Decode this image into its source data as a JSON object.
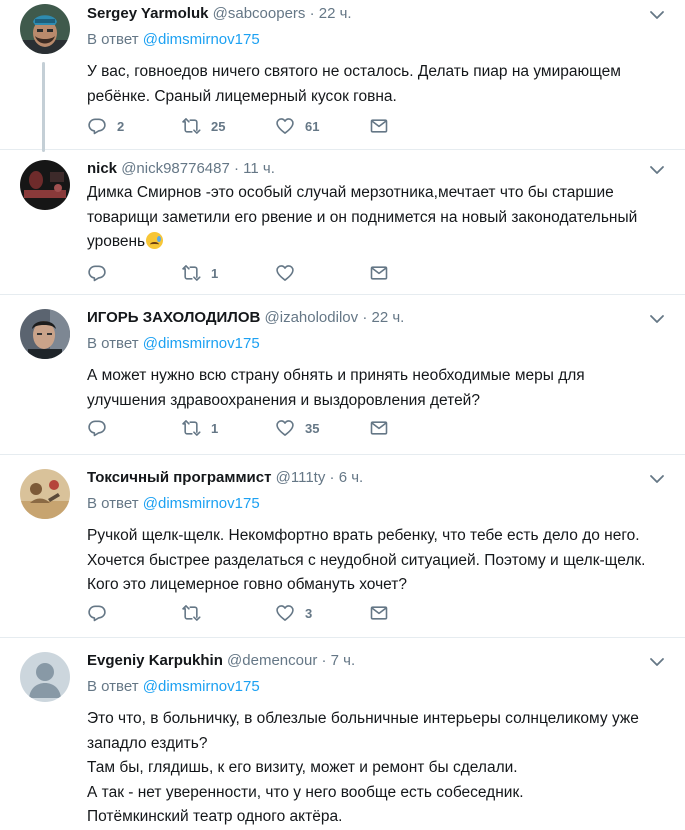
{
  "tweets": [
    {
      "fullname": "Sergey Yarmoluk",
      "username": "@sabcoopers",
      "time": "22 ч.",
      "reply_prefix": "В ответ",
      "reply_to": "@dimsmirnov175",
      "text": "У вас, говноедов ничего святого не осталось. Делать пиар на умирающем\nребёнке. Сраный лицемерный кусок говна.",
      "replies": "2",
      "retweets": "25",
      "likes": "61"
    },
    {
      "fullname": "nick",
      "username": "@nick98776487",
      "time": "11 ч.",
      "text": "Димка Смирнов -это особый случай мерзотника,мечтает что бы старшие\nтоварищи заметили его рвение и он поднимется на новый законодательный\nуровень",
      "replies": "",
      "retweets": "1",
      "likes": ""
    },
    {
      "fullname": "ИГОРЬ ЗАХОЛОДИЛОВ",
      "username": "@izaholodilov",
      "time": "22 ч.",
      "reply_prefix": "В ответ",
      "reply_to": "@dimsmirnov175",
      "text": "А может нужно всю страну обнять и принять необходимые меры для\nулучшения  здравоохранения и  выздоровления детей?",
      "replies": "",
      "retweets": "1",
      "likes": "35"
    },
    {
      "fullname": "Токсичный программист",
      "username": "@111ty",
      "time": "6 ч.",
      "reply_prefix": "В ответ",
      "reply_to": "@dimsmirnov175",
      "text": "Ручкой щелк-щелк. Некомфортно врать ребенку, что тебе есть дело до него.\nХочется быстрее разделаться с неудобной ситуацией. Поэтому и щелк-щелк.\nКого это лицемерное говно обмануть хочет?",
      "replies": "",
      "retweets": "",
      "likes": "3"
    },
    {
      "fullname": "Evgeniy Karpukhin",
      "username": "@demencour",
      "time": "7 ч.",
      "reply_prefix": "В ответ",
      "reply_to": "@dimsmirnov175",
      "text": "Это что, в больничку, в облезлые больничные интерьеры солнцеликому уже\nзападло ездить?\nТам бы, глядишь, к его визиту, может и ремонт бы сделали.\nА так - нет уверенности, что у него  вообще есть собеседник.\nПотёмкинский театр одного актёра."
    }
  ],
  "colors": {
    "link": "#1da1f2",
    "muted": "#657786",
    "divider": "#e6ecf0",
    "thread_line": "#c4cfd6"
  },
  "icons": [
    "reply-icon",
    "retweet-icon",
    "like-icon",
    "dm-icon",
    "caret-down-icon"
  ]
}
